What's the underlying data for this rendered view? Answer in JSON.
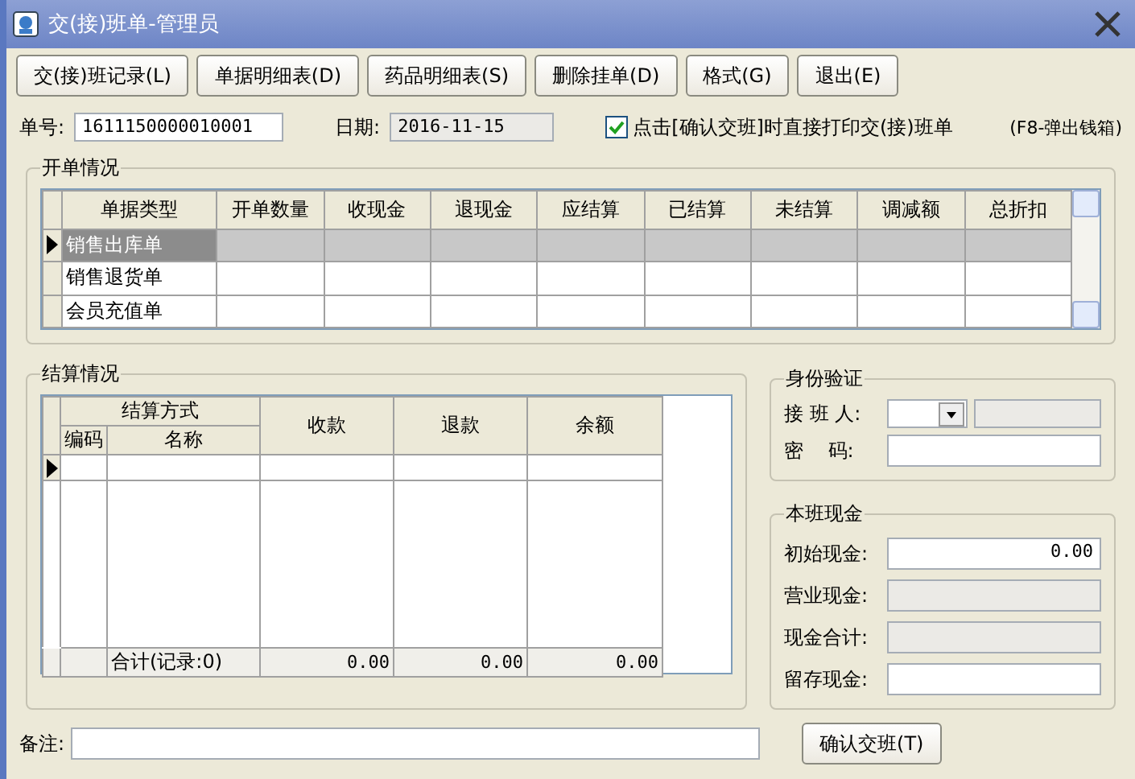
{
  "window": {
    "title": "交(接)班单-管理员"
  },
  "toolbar": [
    {
      "label": "交(接)班记录(L)"
    },
    {
      "label": "单据明细表(D)"
    },
    {
      "label": "药品明细表(S)"
    },
    {
      "label": "删除挂单(D)"
    },
    {
      "label": "格式(G)"
    },
    {
      "label": "退出(E)"
    }
  ],
  "header": {
    "order_label": "单号:",
    "order_value": "1611150000010001",
    "date_label": "日期:",
    "date_value": "2016-11-15",
    "print_option": {
      "label": "点击[确认交班]时直接打印交(接)班单",
      "checked": true
    },
    "hint": "(F8-弹出钱箱)"
  },
  "orders": {
    "title": "开单情况",
    "columns": [
      "单据类型",
      "开单数量",
      "收现金",
      "退现金",
      "应结算",
      "已结算",
      "未结算",
      "调减额",
      "总折扣"
    ],
    "rows": [
      {
        "type": "销售出库单",
        "selected": true
      },
      {
        "type": "销售退货单",
        "selected": false
      },
      {
        "type": "会员充值单",
        "selected": false
      }
    ]
  },
  "settlement": {
    "title": "结算情况",
    "group_header": "结算方式",
    "sub_columns": [
      "编码",
      "名称"
    ],
    "columns": [
      "收款",
      "退款",
      "余额"
    ],
    "total_label": "合计(记录:0)",
    "totals": [
      "0.00",
      "0.00",
      "0.00"
    ]
  },
  "identity": {
    "title": "身份验证",
    "receiver_label": "接 班 人:",
    "password_label": "密    码:"
  },
  "cash": {
    "title": "本班现金",
    "fields": [
      {
        "label": "初始现金:",
        "value": "0.00",
        "disabled": false
      },
      {
        "label": "营业现金:",
        "disabled": true
      },
      {
        "label": "现金合计:",
        "disabled": true
      },
      {
        "label": "留存现金:",
        "disabled": false
      }
    ]
  },
  "remark": {
    "label": "备注:"
  },
  "confirm_button": {
    "label": "确认交班(T)"
  }
}
